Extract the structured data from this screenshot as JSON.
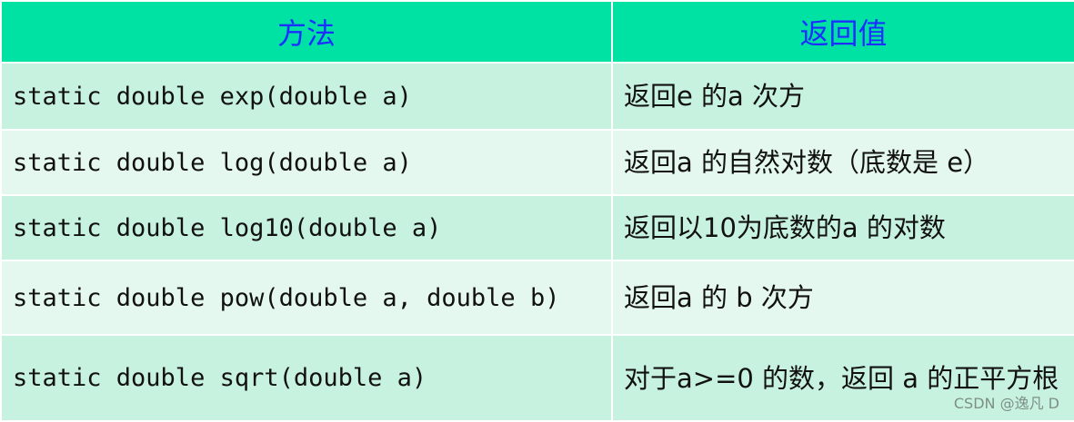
{
  "table": {
    "headers": [
      "方法",
      "返回值"
    ],
    "rows": [
      {
        "method": "static double exp(double a)",
        "returns": "返回e 的a 次方"
      },
      {
        "method": "static double log(double a)",
        "returns": "返回a 的自然对数（底数是 e）"
      },
      {
        "method": "static double log10(double a)",
        "returns": "返回以10为底数的a 的对数"
      },
      {
        "method": "static double pow(double a, double b)",
        "returns": "返回a 的 b 次方"
      },
      {
        "method": "static double sqrt(double a)",
        "returns": "对于a>=0 的数，返回 a 的正平方根"
      }
    ]
  },
  "watermark": "CSDN @逸凡 D",
  "colors": {
    "header_bg": "#00e1a4",
    "header_text": "#1c2fff",
    "row_bg": "#c8f2e0",
    "row_alt_bg": "#e4f8ef"
  }
}
